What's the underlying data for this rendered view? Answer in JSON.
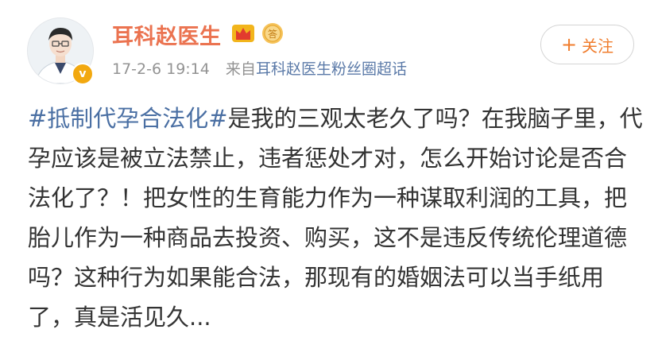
{
  "user": {
    "name": "耳科赵医生",
    "verified_icon": "verified-v-icon",
    "verified_glyph": "v",
    "badges": [
      "crown-icon",
      "medal-icon"
    ],
    "medal_glyph": "答"
  },
  "post": {
    "time": "17-2-6 19:14",
    "source_prefix": "来自",
    "source_name": "耳科赵医生粉丝圈超话",
    "hashtag": "#抵制代孕合法化#",
    "text": "是我的三观太老久了吗？在我脑子里，代孕应该是被立法禁止，违者惩处才对，怎么开始讨论是否合法化了？！把女性的生育能力作为一种谋取利润的工具，把胎儿作为一种商品去投资、购买，这不是违反传统伦理道德吗？这种行为如果能合法，那现有的婚姻法可以当手纸用了，真是活见久..."
  },
  "follow_button": {
    "icon": "plus-icon",
    "plus": "+",
    "label": "关注"
  },
  "colors": {
    "username": "#eb7350",
    "hashtag": "#4a6fa3",
    "source": "#5b7aa8",
    "follow": "#f07d2e",
    "meta": "#939393",
    "text": "#333333"
  }
}
